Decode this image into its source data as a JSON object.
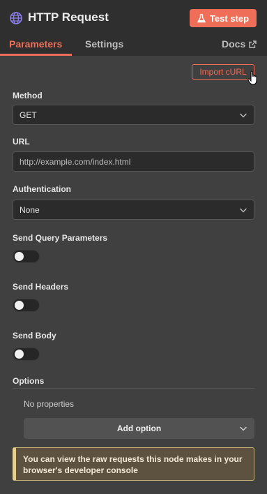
{
  "header": {
    "title": "HTTP Request",
    "test_step_label": "Test step"
  },
  "tabs": {
    "parameters": "Parameters",
    "settings": "Settings",
    "docs": "Docs",
    "active": "Parameters"
  },
  "import_curl_label": "Import cURL",
  "method": {
    "label": "Method",
    "value": "GET"
  },
  "url": {
    "label": "URL",
    "placeholder": "http://example.com/index.html"
  },
  "authentication": {
    "label": "Authentication",
    "value": "None"
  },
  "toggles": {
    "query": {
      "label": "Send Query Parameters",
      "on": false
    },
    "headers": {
      "label": "Send Headers",
      "on": false
    },
    "body": {
      "label": "Send Body",
      "on": false
    }
  },
  "options": {
    "label": "Options",
    "empty_text": "No properties",
    "add_label": "Add option"
  },
  "notice": {
    "text": "You can view the raw requests this node makes in your browser's developer console"
  },
  "colors": {
    "accent": "#ef6e57",
    "background": "#404040",
    "header_bg": "#2f2f2f",
    "notice_bg": "#5d5140",
    "notice_border": "#e9cf8f"
  },
  "icons": [
    "globe-icon",
    "flask-icon",
    "external-link-icon",
    "chevron-down-icon",
    "hand-pointer-cursor-icon"
  ]
}
